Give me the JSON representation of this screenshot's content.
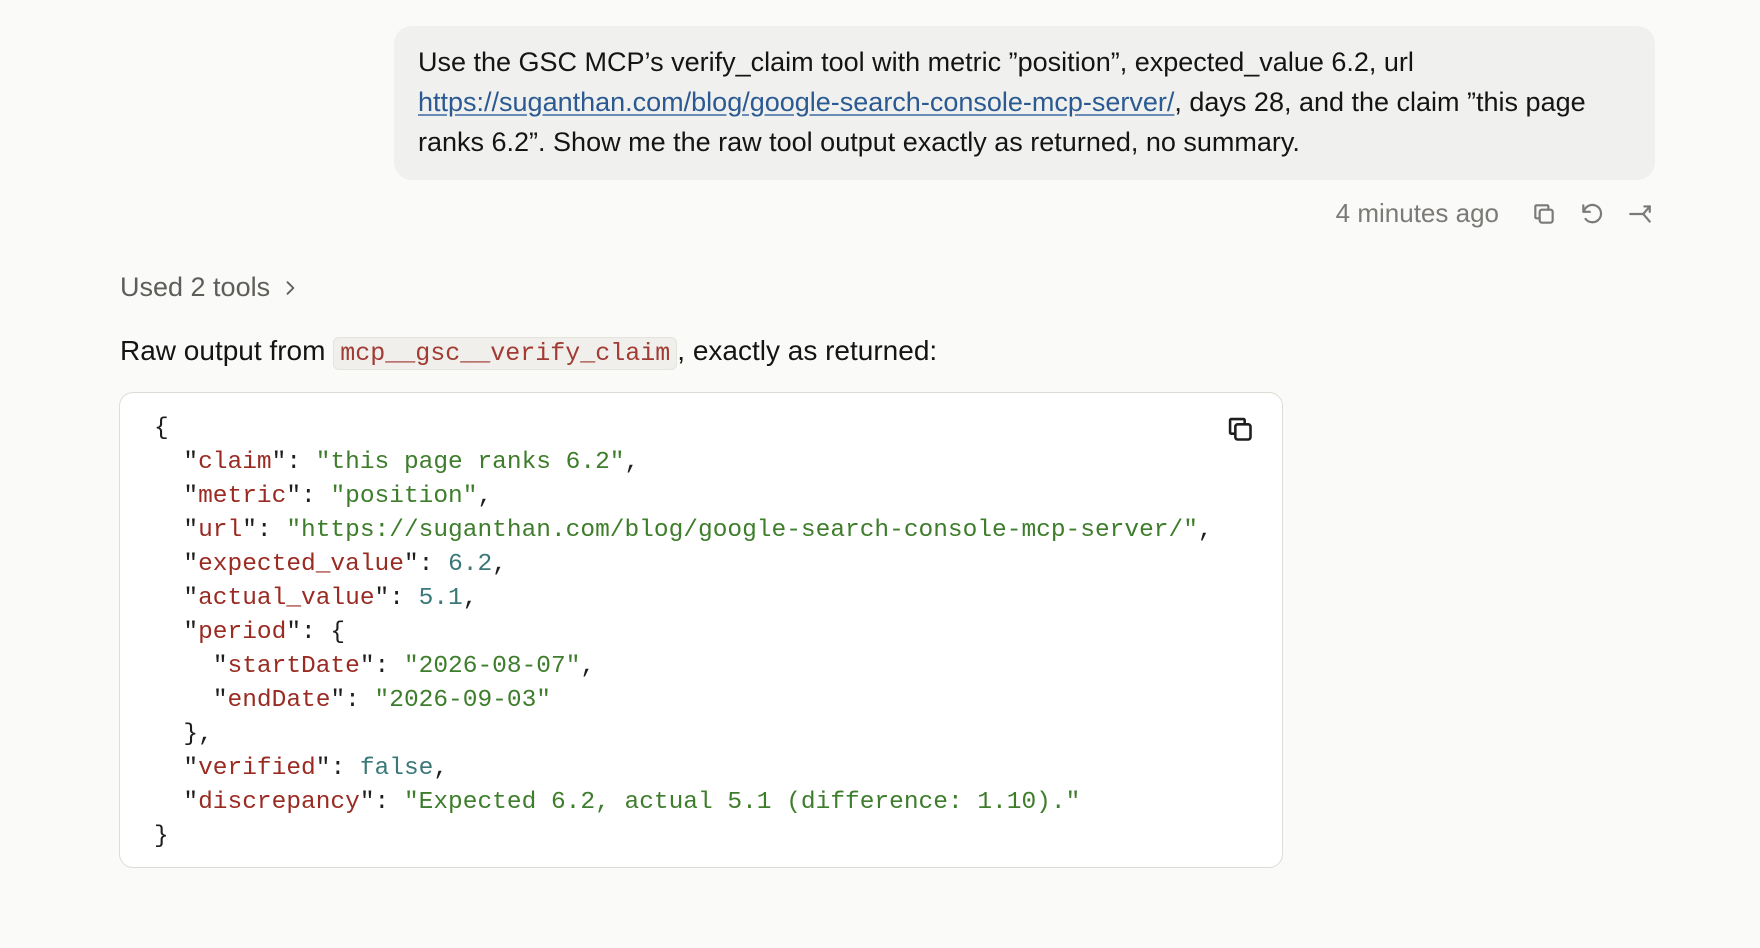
{
  "user_message": {
    "part1": "Use the GSC MCP’s verify_claim tool with metric ”position”, expected_value 6.2, url ",
    "link": "https://suganthan.com/blog/google-search-console-mcp-server/",
    "part2": ", days 28, and the claim ”this page ranks 6.2”. Show me the raw tool output exactly as returned, no summary."
  },
  "meta": {
    "timestamp": "4 minutes ago",
    "icons": [
      "copy-icon",
      "retry-icon",
      "share-icon"
    ]
  },
  "tools_used": {
    "label": "Used 2 tools",
    "icon": "chevron-right-icon"
  },
  "response": {
    "intro_prefix": "Raw output from ",
    "intro_code": "mcp__gsc__verify_claim",
    "intro_suffix": ", exactly as returned:"
  },
  "code_block": {
    "copy_icon": "copy-icon",
    "json": {
      "claim": "this page ranks 6.2",
      "metric": "position",
      "url": "https://suganthan.com/blog/google-search-console-mcp-server/",
      "expected_value": "6.2",
      "actual_value": "5.1",
      "start_date": "2026-08-07",
      "end_date": "2026-09-03",
      "verified": "false",
      "discrepancy": "Expected 6.2, actual 5.1 (difference: 1.10)."
    }
  }
}
